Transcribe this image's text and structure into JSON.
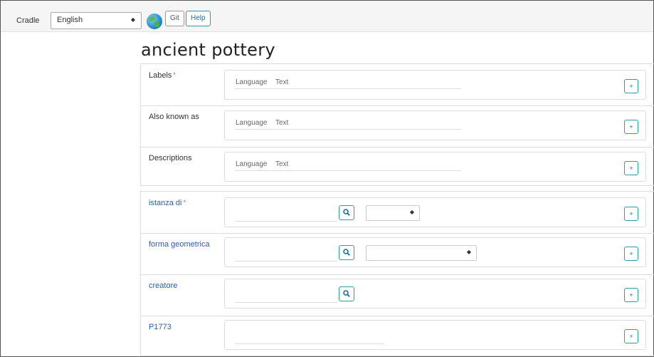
{
  "nav": {
    "brand": "Cradle",
    "language": "English",
    "git_label": "Git",
    "help_label": "Help"
  },
  "page": {
    "title": "ancient pottery"
  },
  "lt_fields": {
    "language_placeholder": "Language",
    "text_placeholder": "Text"
  },
  "terms": [
    {
      "label": "Labels",
      "required": "*"
    },
    {
      "label": "Also known as"
    },
    {
      "label": "Descriptions"
    }
  ],
  "statements": [
    {
      "label": "istanza di",
      "required": "*"
    },
    {
      "label": "forma geometrica"
    },
    {
      "label": "creatore"
    },
    {
      "label": "P1773"
    }
  ],
  "buttons": {
    "add": "+"
  }
}
